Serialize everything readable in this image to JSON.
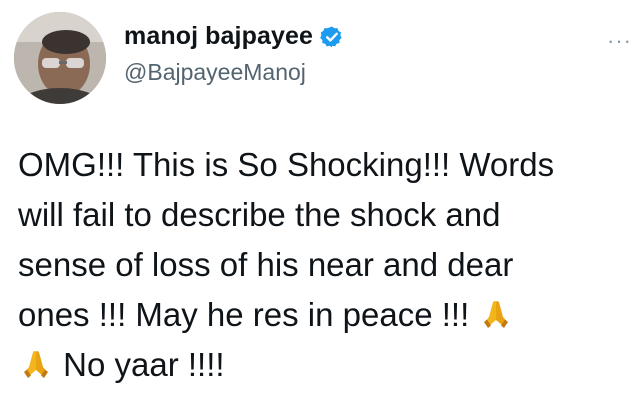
{
  "tweet": {
    "author": {
      "display_name": "manoj bajpayee",
      "handle": "@BajpayeeManoj",
      "verified": true,
      "verified_color": "#1d9bf0"
    },
    "more_menu_label": "···",
    "text_lines": [
      "OMG!!! This is So Shocking!!! Words",
      "will fail to describe the shock and",
      "sense of loss of his near and dear",
      "ones !!! May he res in peace !!! ",
      " No yaar !!!!"
    ],
    "emoji": "folded-hands-icon",
    "colors": {
      "text": "#0f1419",
      "secondary": "#536471",
      "emoji": "#f3b51c"
    }
  }
}
